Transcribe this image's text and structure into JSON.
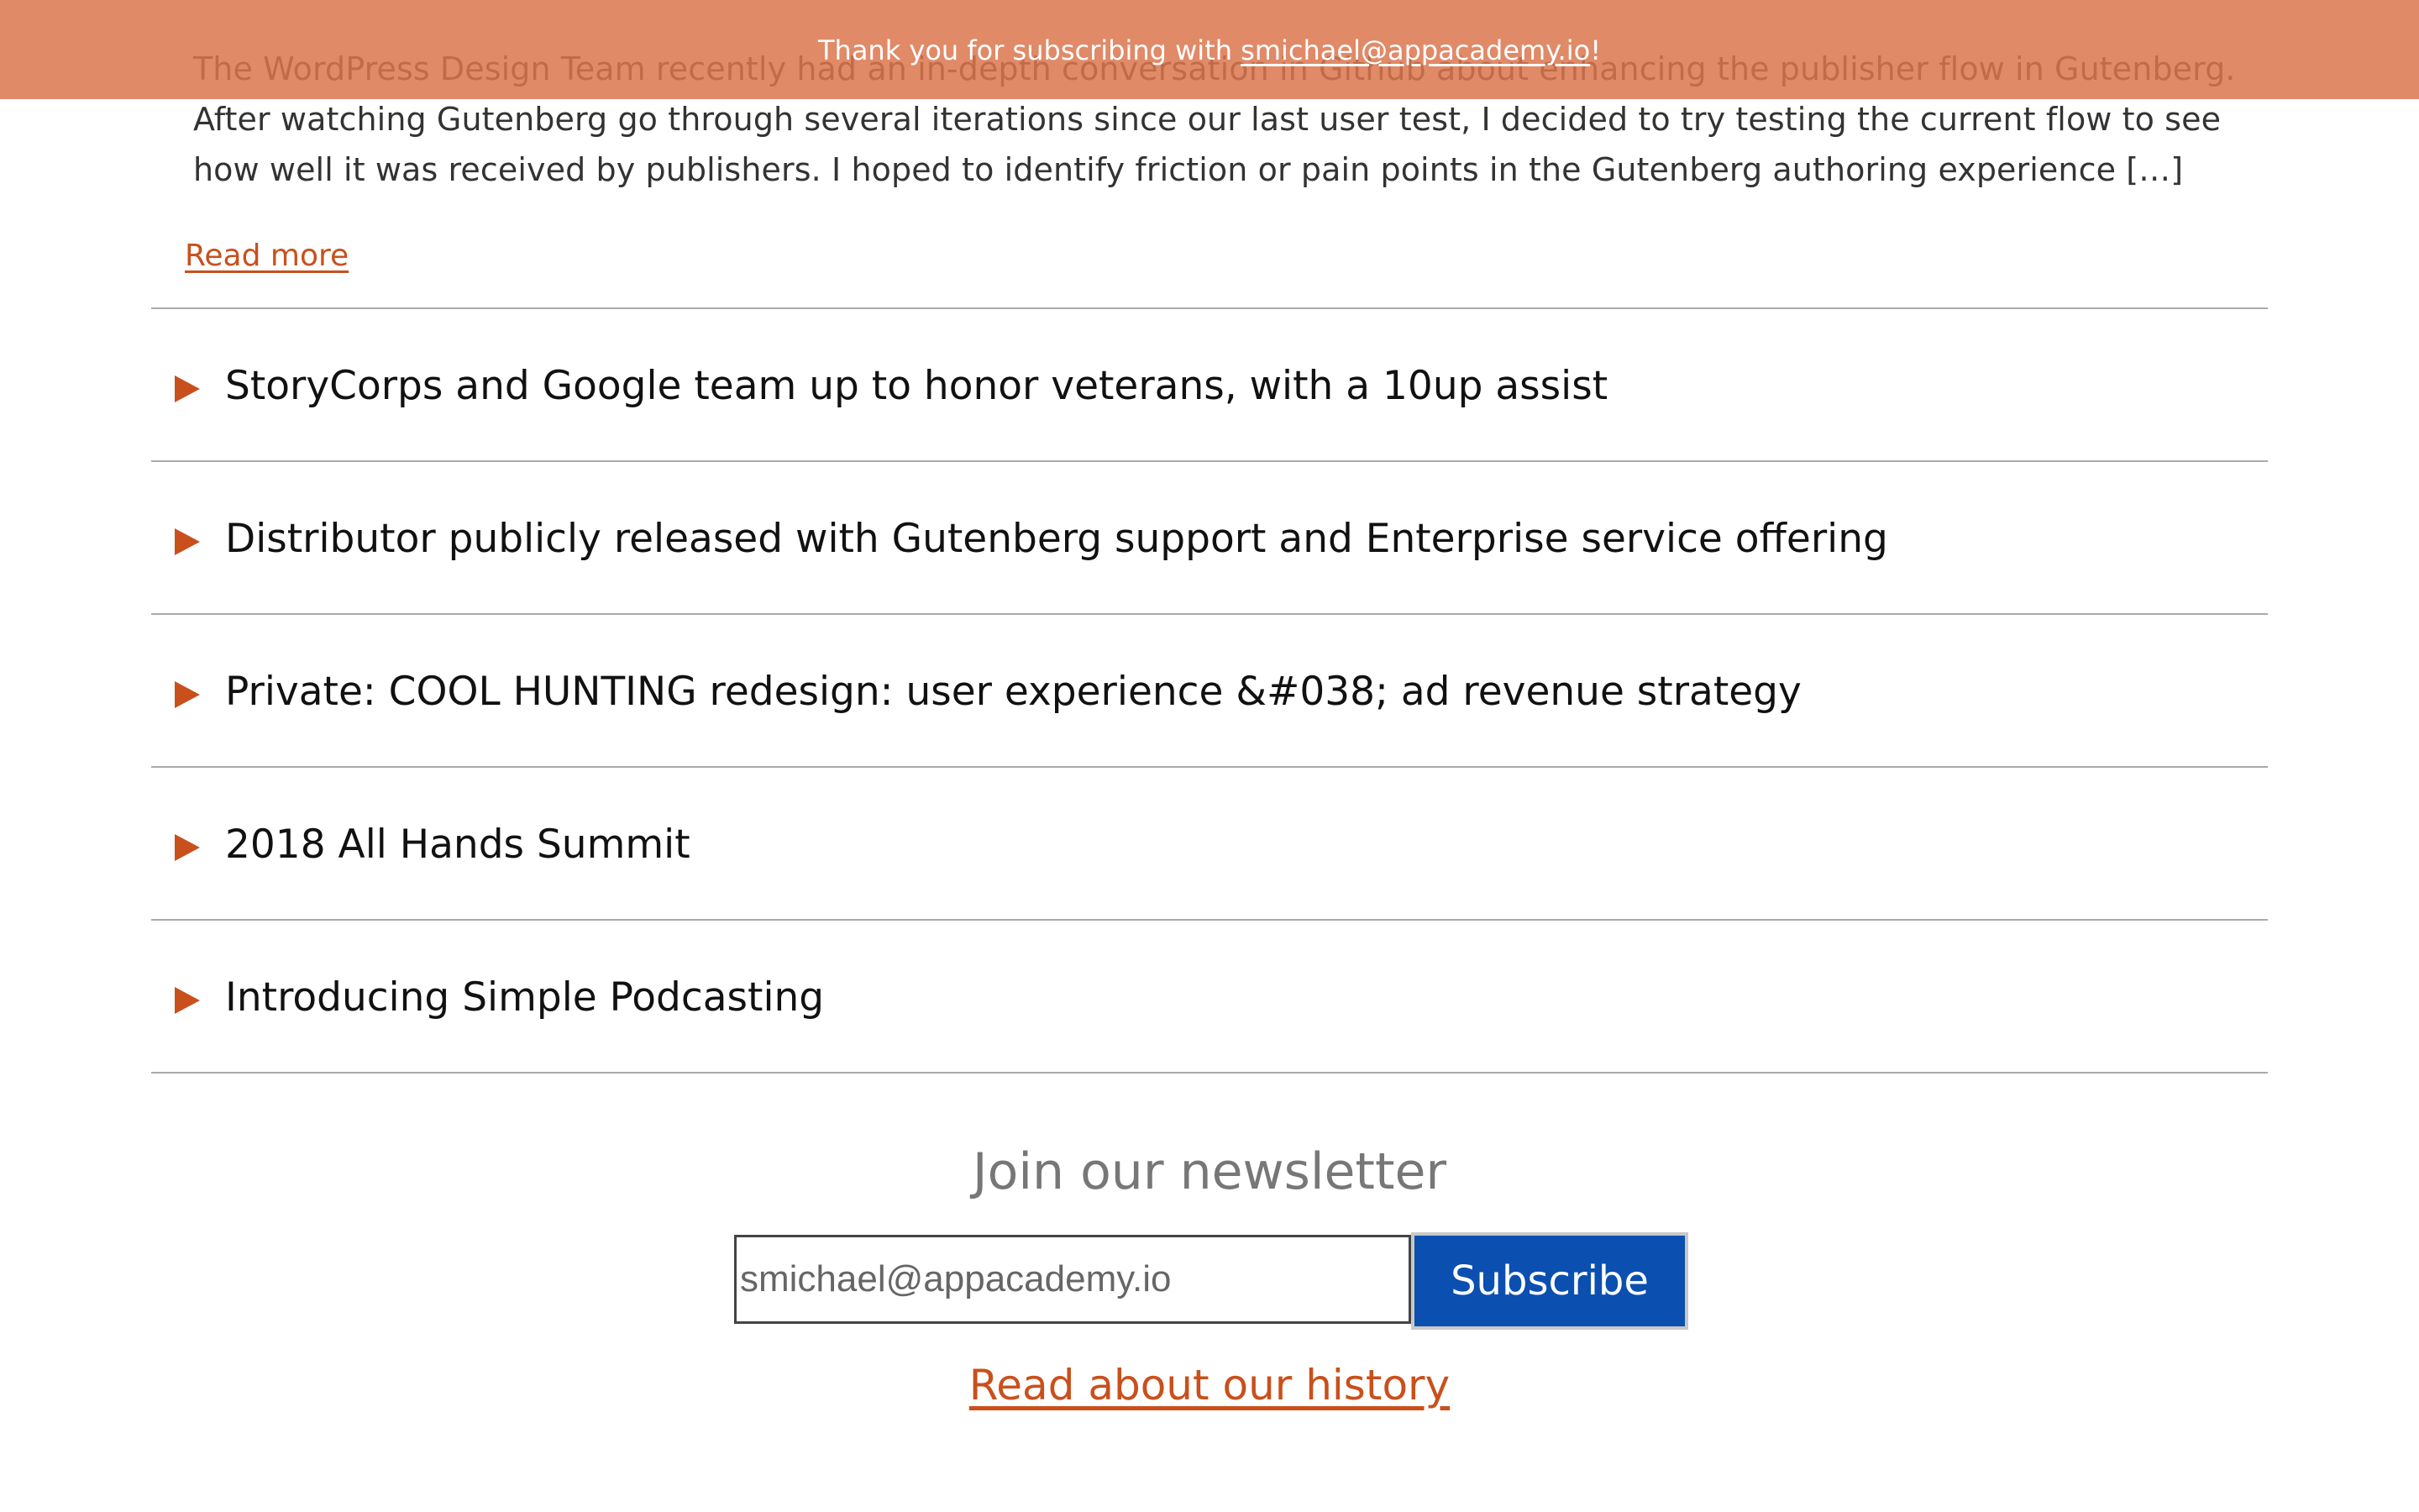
{
  "article": {
    "excerpt": "The WordPress Design Team recently had an in-depth conversation in Github about enhancing the publisher flow in Gutenberg. After watching Gutenberg go through several iterations since our last user test, I decided to try testing the current flow to see how well it was received by publishers. I hoped to identify friction or pain points in the Gutenberg authoring experience […]",
    "read_more_label": "Read more"
  },
  "posts": [
    {
      "title": "StoryCorps and Google team up to honor veterans, with a 10up assist"
    },
    {
      "title": "Distributor publicly released with Gutenberg support and Enterprise service offering"
    },
    {
      "title": "Private: COOL HUNTING redesign: user experience &#038; ad revenue strategy"
    },
    {
      "title": "2018 All Hands Summit"
    },
    {
      "title": "Introducing Simple Podcasting"
    }
  ],
  "newsletter": {
    "title": "Join our newsletter",
    "email_value": "smichael@appacademy.io",
    "subscribe_label": "Subscribe",
    "history_link": "Read about our history"
  },
  "notice": {
    "prefix": "Thank you for subscribing with ",
    "email": "smichael@appacademy.io",
    "suffix": "!"
  },
  "colors": {
    "accent": "#c9501c",
    "notice_bg": "#da754e",
    "button_bg": "#0b4fb0"
  },
  "icons": {
    "post_toggle": "caret-right-icon"
  }
}
